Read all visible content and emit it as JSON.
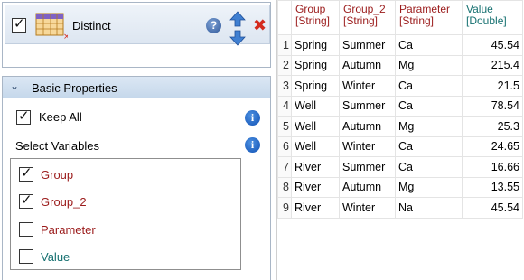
{
  "node": {
    "title": "Distinct",
    "checked": true,
    "help_icon": "question-icon",
    "move_up_icon": "arrow-up-icon",
    "move_down_icon": "arrow-down-icon",
    "remove_icon": "close-icon"
  },
  "properties": {
    "section_title": "Basic Properties",
    "keep_all_label": "Keep All",
    "keep_all_checked": true,
    "select_variables_label": "Select Variables",
    "variables": [
      {
        "label": "Group",
        "checked": true,
        "color": "#9b1b1b"
      },
      {
        "label": "Group_2",
        "checked": true,
        "color": "#9b1b1b"
      },
      {
        "label": "Parameter",
        "checked": false,
        "color": "#9b1b1b"
      },
      {
        "label": "Value",
        "checked": false,
        "color": "#157070"
      }
    ]
  },
  "table": {
    "columns": [
      {
        "name": "Group",
        "type": "[String]"
      },
      {
        "name": "Group_2",
        "type": "[String]"
      },
      {
        "name": "Parameter",
        "type": "[String]"
      },
      {
        "name": "Value",
        "type": "[Double]"
      }
    ],
    "rows": [
      {
        "n": "1",
        "cells": [
          "Spring",
          "Summer",
          "Ca",
          "45.54"
        ]
      },
      {
        "n": "2",
        "cells": [
          "Spring",
          "Autumn",
          "Mg",
          "215.4"
        ]
      },
      {
        "n": "3",
        "cells": [
          "Spring",
          "Winter",
          "Ca",
          "21.5"
        ]
      },
      {
        "n": "4",
        "cells": [
          "Well",
          "Summer",
          "Ca",
          "78.54"
        ]
      },
      {
        "n": "5",
        "cells": [
          "Well",
          "Autumn",
          "Mg",
          "25.3"
        ]
      },
      {
        "n": "6",
        "cells": [
          "Well",
          "Winter",
          "Ca",
          "24.65"
        ]
      },
      {
        "n": "7",
        "cells": [
          "River",
          "Summer",
          "Ca",
          "16.66"
        ]
      },
      {
        "n": "8",
        "cells": [
          "River",
          "Autumn",
          "Mg",
          "13.55"
        ]
      },
      {
        "n": "9",
        "cells": [
          "River",
          "Winter",
          "Na",
          "45.54"
        ]
      }
    ]
  },
  "colors": {
    "string_column": "#9b1b1b",
    "double_column": "#157070",
    "panel_header": "#c6d8eb",
    "remove": "#d42b1e"
  }
}
